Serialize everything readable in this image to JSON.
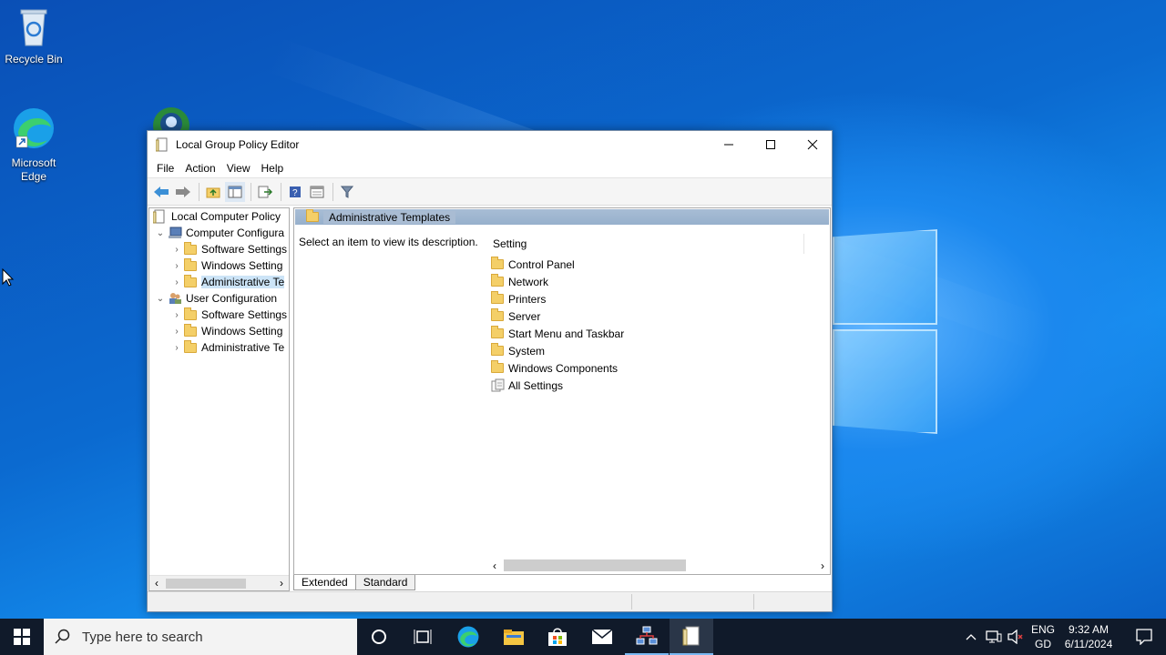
{
  "desktop": {
    "icons": [
      {
        "label": "Recycle Bin"
      },
      {
        "label": "Microsoft Edge"
      }
    ]
  },
  "window": {
    "title": "Local Group Policy Editor",
    "menu": [
      "File",
      "Action",
      "View",
      "Help"
    ],
    "tree": {
      "root": "Local Computer Policy",
      "computer_config": "Computer Configura",
      "computer_children": [
        "Software Settings",
        "Windows Setting",
        "Administrative Te"
      ],
      "user_config": "User Configuration",
      "user_children": [
        "Software Settings",
        "Windows Setting",
        "Administrative Te"
      ]
    },
    "details": {
      "header": "Administrative Templates",
      "description": "Select an item to view its description.",
      "column": "Setting",
      "items": [
        "Control Panel",
        "Network",
        "Printers",
        "Server",
        "Start Menu and Taskbar",
        "System",
        "Windows Components",
        "All Settings"
      ]
    },
    "tabs": [
      "Extended",
      "Standard"
    ]
  },
  "taskbar": {
    "search_placeholder": "Type here to search",
    "lang_top": "ENG",
    "lang_bottom": "GD",
    "time": "9:32 AM",
    "date": "6/11/2024"
  },
  "colors": {
    "accent": "#0078d7",
    "selection": "#cce4f7",
    "taskbar": "#101a2a"
  }
}
